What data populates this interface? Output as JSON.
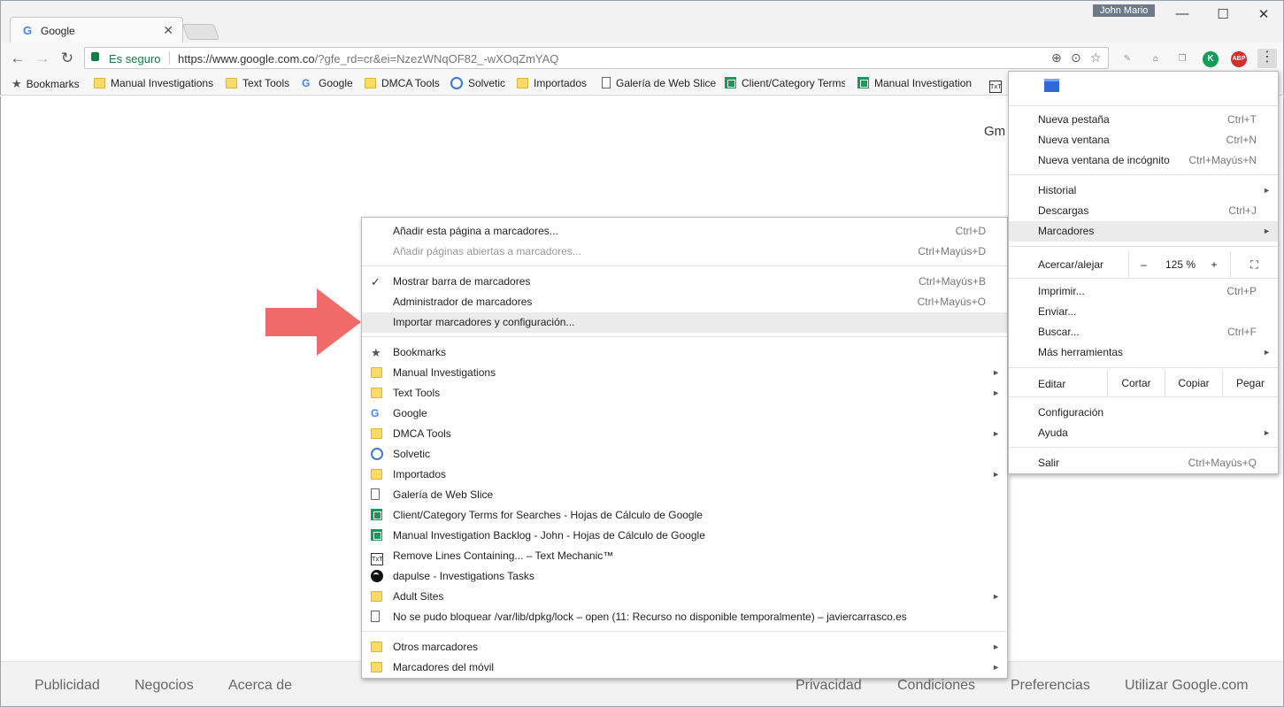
{
  "window": {
    "tab_title": "Google",
    "user_name": "John Mario",
    "minimize": "—",
    "maximize": "☐",
    "close": "✕"
  },
  "toolbar": {
    "secure_label": "Es seguro",
    "url_host": "https://www.google.com.co",
    "url_rest": "/?gfe_rd=cr&ei=NzezWNqOF82_-wXOqZmYAQ"
  },
  "bookmarks_bar": [
    {
      "label": "Bookmarks",
      "icon": "star"
    },
    {
      "label": "Manual Investigations",
      "icon": "folder"
    },
    {
      "label": "Text Tools",
      "icon": "folder"
    },
    {
      "label": "Google",
      "icon": "google"
    },
    {
      "label": "DMCA Tools",
      "icon": "folder"
    },
    {
      "label": "Solvetic",
      "icon": "solvetic"
    },
    {
      "label": "Importados",
      "icon": "folder"
    },
    {
      "label": "Galería de Web Slice",
      "icon": "page"
    },
    {
      "label": "Client/Category Terms",
      "icon": "sheet"
    },
    {
      "label": "Manual Investigation",
      "icon": "sheet"
    }
  ],
  "page": {
    "gmail_partial": "Gm",
    "footer_left": [
      "Publicidad",
      "Negocios",
      "Acerca de"
    ],
    "footer_right": [
      "Privacidad",
      "Condiciones",
      "Preferencias",
      "Utilizar Google.com"
    ]
  },
  "bookmarks_submenu": {
    "add_page": {
      "label": "Añadir esta página a marcadores...",
      "shortcut": "Ctrl+D"
    },
    "add_open": {
      "label": "Añadir páginas abiertas a marcadores...",
      "shortcut": "Ctrl+Mayús+D"
    },
    "show_bar": {
      "label": "Mostrar barra de marcadores",
      "shortcut": "Ctrl+Mayús+B",
      "check": "✓"
    },
    "manager": {
      "label": "Administrador de marcadores",
      "shortcut": "Ctrl+Mayús+O"
    },
    "import": {
      "label": "Importar marcadores y configuración..."
    },
    "items": [
      {
        "label": "Bookmarks",
        "icon": "star",
        "arrow": ""
      },
      {
        "label": "Manual Investigations",
        "icon": "folder",
        "arrow": "►"
      },
      {
        "label": "Text Tools",
        "icon": "folder",
        "arrow": "►"
      },
      {
        "label": "Google",
        "icon": "google",
        "arrow": ""
      },
      {
        "label": "DMCA Tools",
        "icon": "folder",
        "arrow": "►"
      },
      {
        "label": "Solvetic",
        "icon": "solvetic",
        "arrow": ""
      },
      {
        "label": "Importados",
        "icon": "folder",
        "arrow": "►"
      },
      {
        "label": "Galería de Web Slice",
        "icon": "page",
        "arrow": ""
      },
      {
        "label": "Client/Category Terms for Searches - Hojas de Cálculo de Google",
        "icon": "sheet",
        "arrow": ""
      },
      {
        "label": "Manual Investigation Backlog - John - Hojas de Cálculo de Google",
        "icon": "sheet",
        "arrow": ""
      },
      {
        "label": "Remove Lines Containing... – Text Mechanic™",
        "icon": "txt",
        "arrow": ""
      },
      {
        "label": "dapulse - Investigations Tasks",
        "icon": "dapulse",
        "arrow": ""
      },
      {
        "label": "Adult Sites",
        "icon": "folder",
        "arrow": "►"
      },
      {
        "label": "No se pudo bloquear /var/lib/dpkg/lock – open (11: Recurso no disponible temporalmente) – javiercarrasco.es",
        "icon": "page",
        "arrow": ""
      }
    ],
    "other": [
      {
        "label": "Otros marcadores",
        "icon": "folder",
        "arrow": "►"
      },
      {
        "label": "Marcadores del móvil",
        "icon": "folder",
        "arrow": "►"
      }
    ]
  },
  "chrome_menu": {
    "new_tab": {
      "label": "Nueva pestaña",
      "shortcut": "Ctrl+T"
    },
    "new_window": {
      "label": "Nueva ventana",
      "shortcut": "Ctrl+N"
    },
    "incognito": {
      "label": "Nueva ventana de incógnito",
      "shortcut": "Ctrl+Mayús+N"
    },
    "history": {
      "label": "Historial",
      "arrow": "►"
    },
    "downloads": {
      "label": "Descargas",
      "shortcut": "Ctrl+J"
    },
    "bookmarks": {
      "label": "Marcadores",
      "arrow": "►"
    },
    "zoom": {
      "label": "Acercar/alejar",
      "minus": "–",
      "value": "125 %",
      "plus": "+",
      "fullscreen": "⛶"
    },
    "print": {
      "label": "Imprimir...",
      "shortcut": "Ctrl+P"
    },
    "cast": {
      "label": "Enviar..."
    },
    "find": {
      "label": "Buscar...",
      "shortcut": "Ctrl+F"
    },
    "more_tools": {
      "label": "Más herramientas",
      "arrow": "►"
    },
    "edit": {
      "label": "Editar",
      "cut": "Cortar",
      "copy": "Copiar",
      "paste": "Pegar"
    },
    "settings": {
      "label": "Configuración"
    },
    "help": {
      "label": "Ayuda",
      "arrow": "►"
    },
    "exit": {
      "label": "Salir",
      "shortcut": "Ctrl+Mayús+Q"
    }
  },
  "colors": {
    "secure_green": "#0b8043",
    "arrow_red": "#f06a6a",
    "highlight": "#ebebeb"
  }
}
